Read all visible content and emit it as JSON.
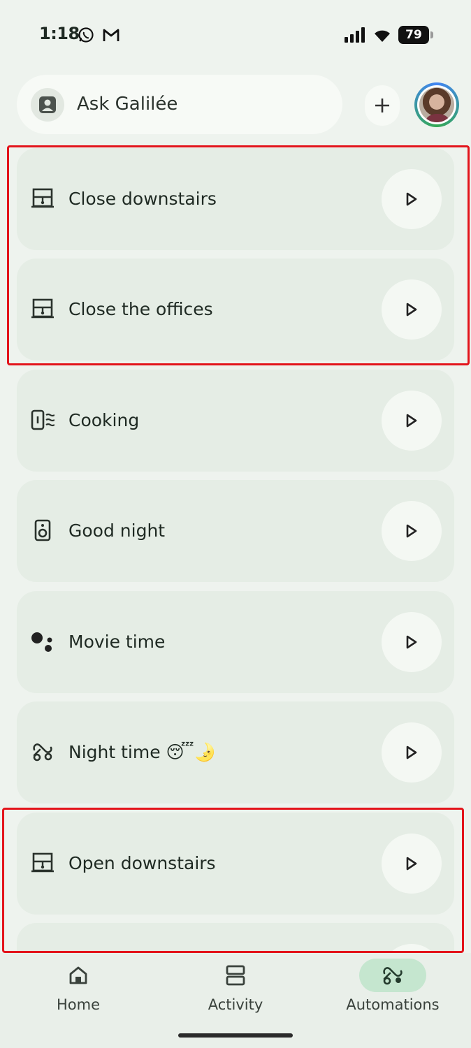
{
  "status_bar": {
    "time": "1:18",
    "battery": "79"
  },
  "search": {
    "label": "Ask Galilée"
  },
  "routines": [
    {
      "label": "Close downstairs",
      "icon": "blinds-icon"
    },
    {
      "label": "Close the offices",
      "icon": "blinds-icon"
    },
    {
      "label": "Cooking",
      "icon": "range-hood-icon"
    },
    {
      "label": "Good night",
      "icon": "speaker-icon"
    },
    {
      "label": "Movie time",
      "icon": "google-assistant-icon"
    },
    {
      "label": "Night time 😴🌛",
      "icon": "routine-icon"
    },
    {
      "label": "Open downstairs",
      "icon": "blinds-icon"
    }
  ],
  "nav": {
    "home": "Home",
    "activity": "Activity",
    "automations": "Automations",
    "active": "automations"
  },
  "colors": {
    "accent": "#c5e6cf",
    "highlight": "#e3141b",
    "card": "#e5ede5",
    "background": "#eef3ee"
  }
}
